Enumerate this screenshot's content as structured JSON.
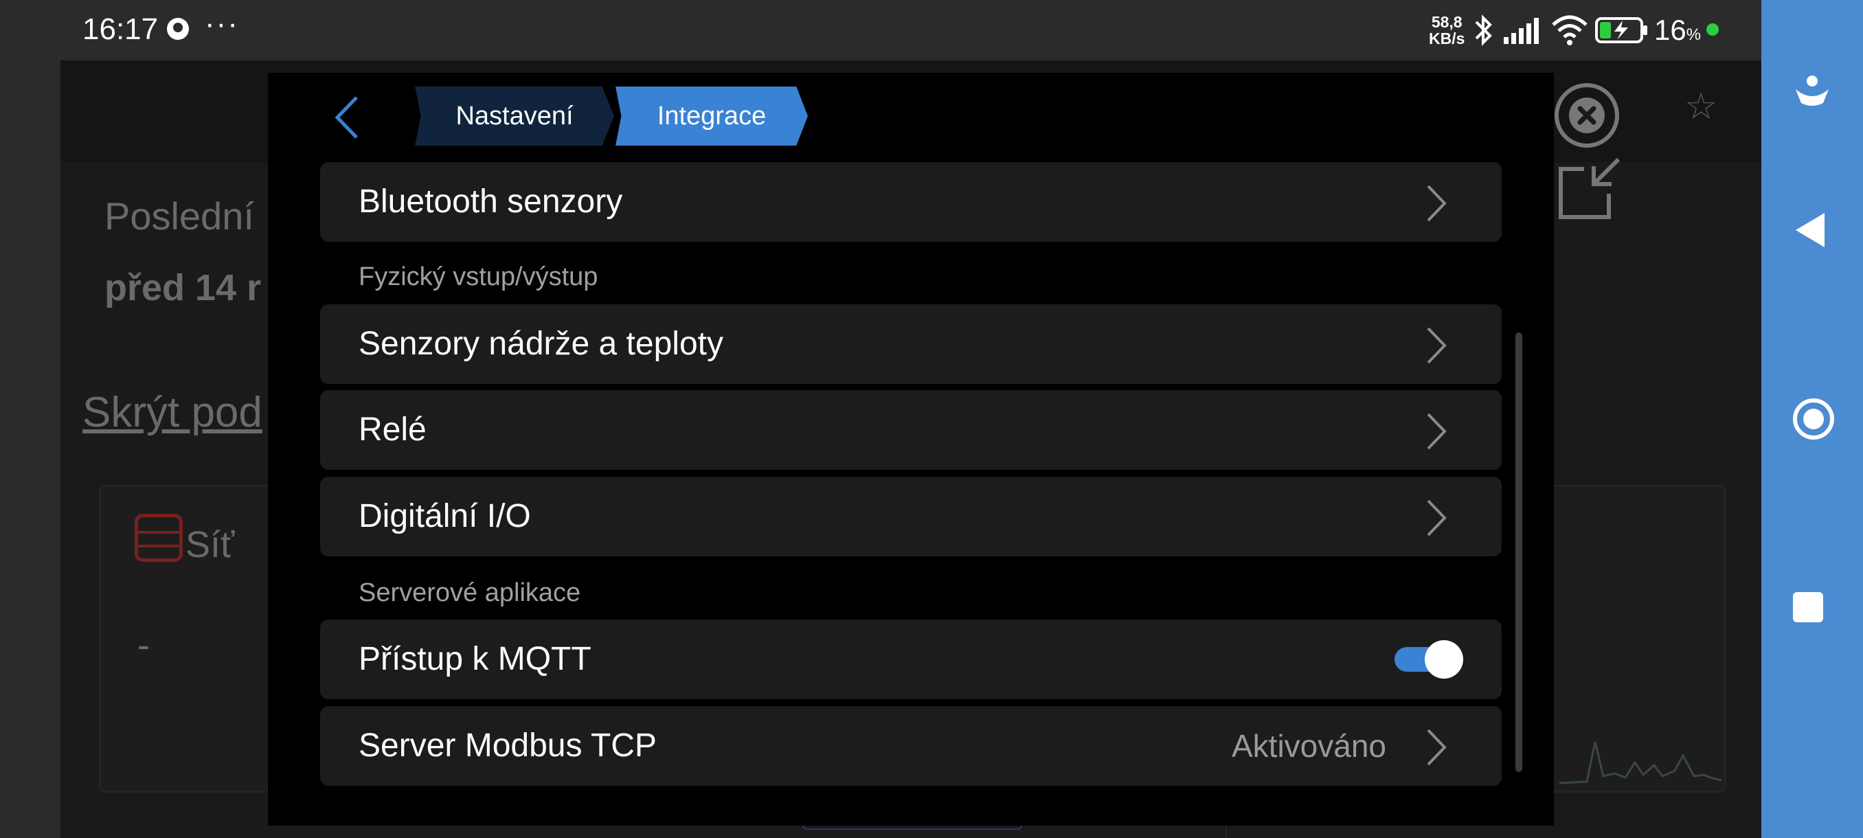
{
  "status_bar": {
    "time": "16:17",
    "dots": "···",
    "net_rate_top": "58,8",
    "net_rate_bottom": "KB/s",
    "battery_percent": "16",
    "battery_unit": "%",
    "icons": [
      "app-notification-icon",
      "bluetooth-icon",
      "signal-icon",
      "wifi-icon",
      "battery-charging-icon"
    ]
  },
  "background_app": {
    "last_label": "Poslední",
    "time_text": "před 14 r",
    "hide_link": "Skrýt pod",
    "grid_card_label": "Síť",
    "grid_card_value": "-"
  },
  "modal": {
    "breadcrumbs": [
      "Nastavení",
      "Integrace"
    ],
    "rows_top": [
      {
        "label": "Bluetooth senzory"
      }
    ],
    "section_io": "Fyzický vstup/výstup",
    "rows_io": [
      {
        "label": "Senzory nádrže a teploty"
      },
      {
        "label": "Relé"
      },
      {
        "label": "Digitální I/O"
      }
    ],
    "section_server": "Serverové aplikace",
    "mqtt_label": "Přístup k MQTT",
    "mqtt_enabled": true,
    "modbus_label": "Server Modbus TCP",
    "modbus_value": "Aktivováno"
  },
  "colors": {
    "accent": "#3a82d3",
    "crumb_inactive": "#10243d",
    "row_bg": "#1c1c1c",
    "navbar": "#4a8bd1"
  }
}
